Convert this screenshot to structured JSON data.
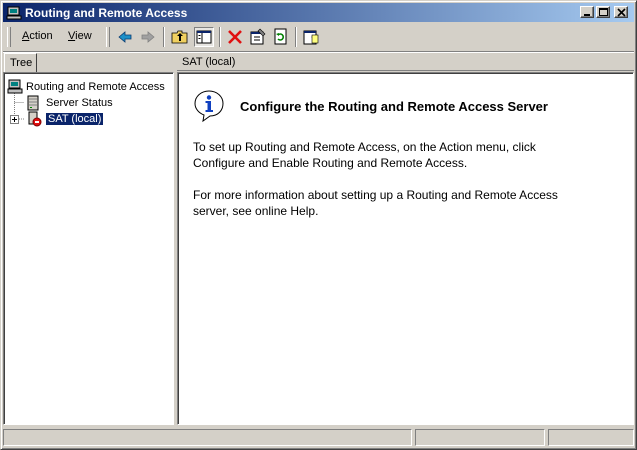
{
  "window": {
    "title": "Routing and Remote Access"
  },
  "menu": {
    "action": "Action",
    "view": "View"
  },
  "toolbar_icons": [
    "back-arrow-icon",
    "forward-arrow-icon",
    "up-folder-icon",
    "show-hide-tree-icon",
    "delete-icon",
    "properties-icon",
    "refresh-icon",
    "help-icon"
  ],
  "tree": {
    "tab_label": "Tree",
    "root": "Routing and Remote Access",
    "items": [
      {
        "label": "Server Status"
      },
      {
        "label": "SAT (local)"
      }
    ]
  },
  "right": {
    "header": "SAT (local)",
    "heading": "Configure the Routing and Remote Access Server",
    "para1_line1": "To set up Routing and Remote Access, on the Action menu, click",
    "para1_line2": "Configure and Enable Routing and Remote Access.",
    "para2_line1": "For more information about setting up a Routing and Remote Access",
    "para2_line2": "server, see online Help."
  },
  "colors": {
    "titlebar_start": "#0a246a",
    "titlebar_end": "#a6caf0",
    "selection": "#0a246a",
    "face": "#d4d0c8"
  }
}
